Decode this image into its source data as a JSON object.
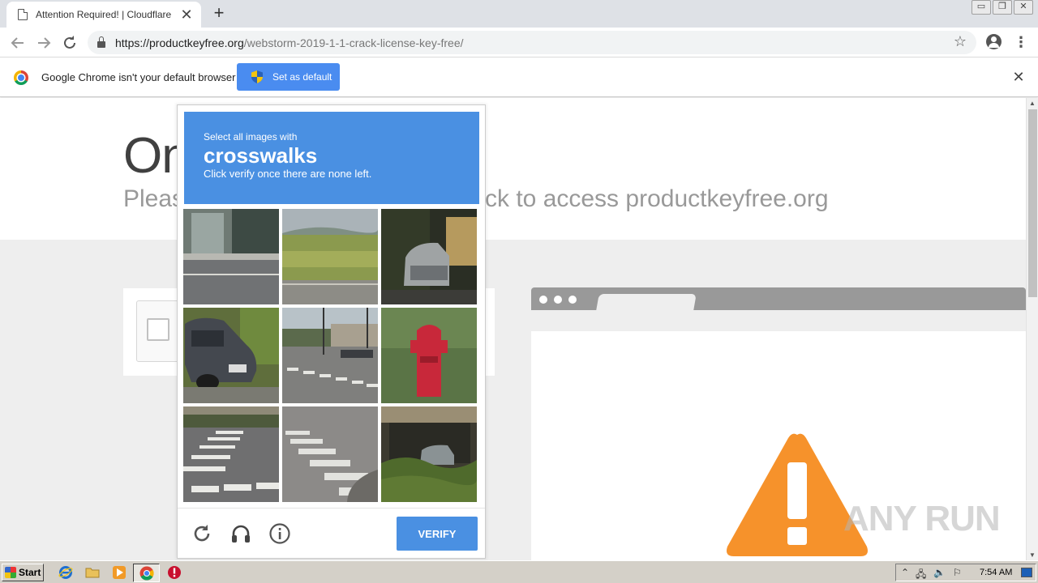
{
  "browser": {
    "tab_title": "Attention Required! | Cloudflare",
    "tab_close": "✕",
    "new_tab": "+",
    "url_host": "https://productkeyfree.org",
    "url_path": "/webstorm-2019-1-1-crack-license-key-free/",
    "window_controls": {
      "minimize": "▭",
      "restore": "❐",
      "close": "✕"
    }
  },
  "infobar": {
    "message": "Google Chrome isn't your default browser",
    "button_label": "Set as default",
    "close": "✕"
  },
  "page": {
    "heading": "On",
    "subheading_left": "Pleas",
    "subheading_right": "ck to access productkeyfree.org"
  },
  "challenge": {
    "instruction": "Select all images with",
    "keyword": "crosswalks",
    "hint": "Click verify once there are none left.",
    "verify_label": "VERIFY",
    "tiles": [
      "building-sidewalk",
      "grass-field",
      "parked-car-dark",
      "parked-sedan",
      "intersection-crosswalk",
      "red-fire-hydrant",
      "crosswalk-corner",
      "crosswalk-street",
      "shrubs-parked-car"
    ]
  },
  "watermark": "ANY RUN",
  "taskbar": {
    "start_label": "Start",
    "clock": "7:54 AM"
  },
  "colors": {
    "challenge_blue": "#4a90e2",
    "warning_orange": "#f6922b",
    "set_default_blue": "#4a8cf0"
  }
}
